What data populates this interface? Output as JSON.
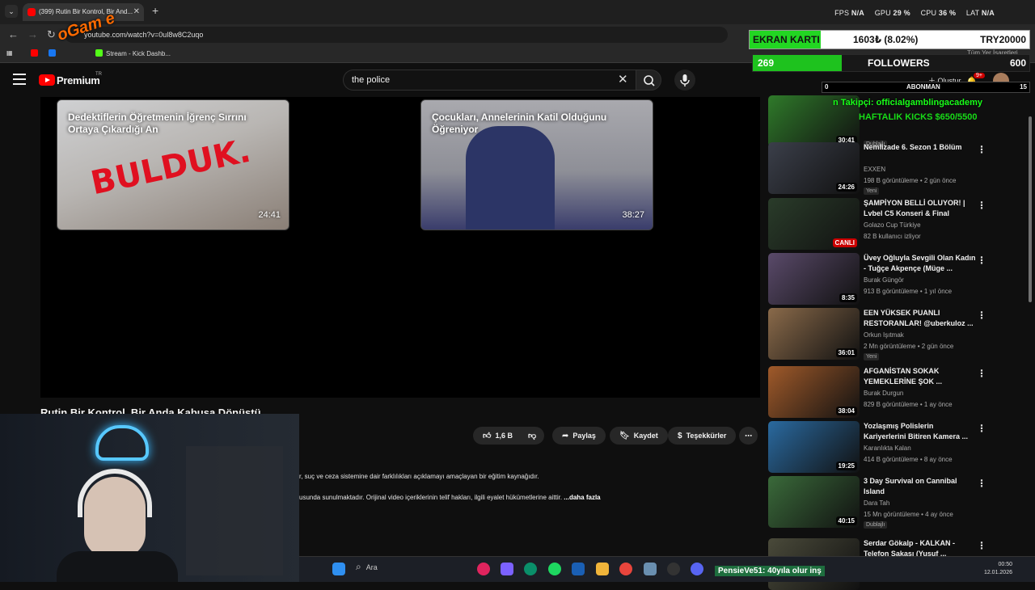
{
  "browser": {
    "tab_title": "(399) Rutin Bir Kontrol, Bir And...",
    "new_tab": "+",
    "url": "youtube.com/watch?v=0ul8w8C2uqo",
    "bookmarks": [
      "Stream - Kick Dashb...",
      "Tüm Yer İşaretleri"
    ],
    "overlay_logo": "oGam e"
  },
  "stats": {
    "fps_label": "FPS",
    "fps": "N/A",
    "gpu_label": "GPU",
    "gpu": "29 %",
    "cpu_label": "CPU",
    "cpu": "36 %",
    "lat_label": "LAT",
    "lat": "N/A"
  },
  "youtube": {
    "brand": "Premium",
    "country": "TR",
    "search_value": "the police",
    "create_label": "Oluştur",
    "notif_count": "9+"
  },
  "widget": {
    "card_label": "EKRAN KARTI",
    "card_value": "1603₺ (8.02%)",
    "card_target": "TRY20000",
    "followers_count": "269",
    "followers_label": "FOLLOWERS",
    "followers_target": "600",
    "sub_count": "0",
    "sub_label": "ABONMAN",
    "sub_target": "15"
  },
  "player": {
    "endcards": [
      {
        "title": "Dedektiflerin Öğretmenin İğrenç Sırrını Ortaya Çıkardığı An",
        "duration": "24:41",
        "stamp": "BULDUK."
      },
      {
        "title": "Çocukları, Annelerinin Katil Olduğunu Öğreniyor",
        "duration": "38:27"
      }
    ],
    "video_title": "Rutin Bir Kontrol, Bir Anda Kabusa Dönüştü",
    "like_count": "1,6 B",
    "share_label": "Paylaş",
    "save_label": "Kaydet",
    "thanks_label": "Teşekkürler",
    "desc_line1": "r, suç ve ceza sistemine dair farklılıkları açıklamayı amaçlayan bir eğitim kaynağıdır.",
    "desc_line2": "usunda sunulmaktadır. Orijinal video içeriklerinin telif hakları, ilgili eyalet hükümetlerine aittir.",
    "desc_more": "...daha fazla"
  },
  "promo": {
    "line1": "n Takipçi: officialgamblingacademy",
    "line2": "HAFTALIK KICKS $650/5500"
  },
  "sidebar": [
    {
      "title": "",
      "channel": "",
      "meta": "",
      "badge": "Dublajlı",
      "duration": "30:41",
      "thumb": "#2f7a2a"
    },
    {
      "title": "Nemlizade 6. Sezon 1 Bölüm",
      "channel": "EXXEN",
      "meta": "198 B görüntüleme • 2 gün önce",
      "badge": "Yeni",
      "duration": "24:26",
      "thumb": "#3b3f4a"
    },
    {
      "title": "ŞAMPİYON BELLİ OLUYOR! | Lvbel C5 Konseri & Final Maçla...",
      "channel": "Golazo Cup Türkiye",
      "meta": "82 B kullanıcı izliyor",
      "badge": "",
      "duration": "CANLI",
      "thumb": "#2a3c2a"
    },
    {
      "title": "Üvey Oğluyla Sevgili Olan Kadın - Tuğçe Akpençe (Müge ...",
      "channel": "Burak Güngör",
      "meta": "913 B görüntüleme • 1 yıl önce",
      "badge": "",
      "duration": "8:35",
      "thumb": "#5a4a6a"
    },
    {
      "title": "EEN YÜKSEK PUANLI RESTORANLAR! @uberkuloz ...",
      "channel": "Orkun Işıtmak",
      "meta": "2 Mn görüntüleme • 2 gün önce",
      "badge": "Yeni",
      "duration": "36:01",
      "thumb": "#8a6a4a"
    },
    {
      "title": "AFGANİSTAN SOKAK YEMEKLERİNE ŞOK ...",
      "channel": "Burak Durgun",
      "meta": "829 B görüntüleme • 1 ay önce",
      "badge": "",
      "duration": "38:04",
      "thumb": "#a05a2a"
    },
    {
      "title": "Yozlaşmış Polislerin Kariyerlerini Bitiren Kamera ...",
      "channel": "Karanlıkta Kalan",
      "meta": "414 B görüntüleme • 8 ay önce",
      "badge": "",
      "duration": "19:25",
      "thumb": "#2a6aa0"
    },
    {
      "title": "3 Day Survival on Cannibal Island",
      "channel": "Dara Tah",
      "meta": "15 Mn görüntüleme • 4 ay önce",
      "badge": "Dublajlı",
      "duration": "40:15",
      "thumb": "#3a6a3a"
    },
    {
      "title": "Serdar Gökalp - KALKAN - Telefon Şakası (Yusuf ...",
      "channel": "",
      "meta": "",
      "badge": "",
      "duration": "",
      "thumb": "#4a4a3a"
    }
  ],
  "taskbar": {
    "search_label": "Ara",
    "overlay_text": "PensieVe51: 40yıla olur inş",
    "time": "00:50",
    "date": "12.01.2026"
  },
  "colors": {
    "yt_red": "#ff0000",
    "widget_green": "#22d622",
    "bg": "#0f0f0f"
  }
}
